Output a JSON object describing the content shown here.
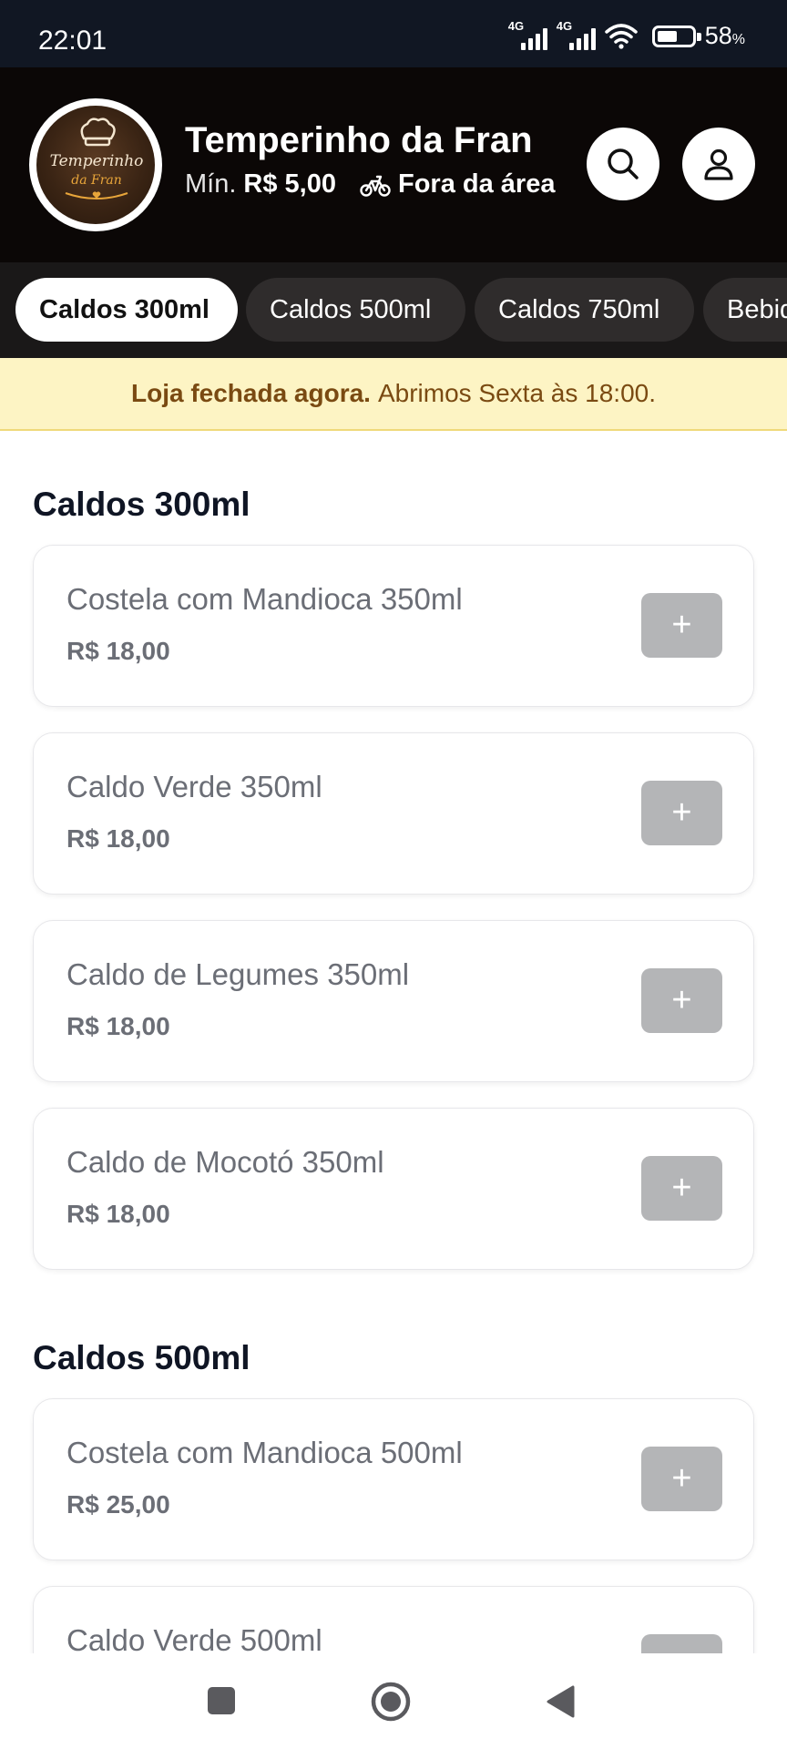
{
  "status_bar": {
    "time": "22:01",
    "network_1": "4G",
    "network_2": "4G",
    "battery_percent": "58",
    "battery_unit": "%",
    "battery_level": 0.58
  },
  "store": {
    "name": "Temperinho da Fran",
    "logo_text_1": "Temperinho",
    "logo_text_2": "da Fran",
    "min_label": "Mín.",
    "min_value": "R$ 5,00",
    "delivery_status": "Fora da área"
  },
  "tabs": [
    {
      "label": "Caldos 300ml",
      "active": true
    },
    {
      "label": "Caldos 500ml",
      "active": false
    },
    {
      "label": "Caldos 750ml",
      "active": false
    },
    {
      "label": "Bebidas",
      "active": false
    }
  ],
  "banner": {
    "strong": "Loja fechada agora.",
    "text": "Abrimos Sexta às 18:00."
  },
  "sections": [
    {
      "title": "Caldos 300ml",
      "products": [
        {
          "name": "Costela com Mandioca 350ml",
          "price": "R$ 18,00"
        },
        {
          "name": "Caldo Verde 350ml",
          "price": "R$ 18,00"
        },
        {
          "name": "Caldo de Legumes 350ml",
          "price": "R$ 18,00"
        },
        {
          "name": "Caldo de Mocotó 350ml",
          "price": "R$ 18,00"
        }
      ]
    },
    {
      "title": "Caldos 500ml",
      "products": [
        {
          "name": "Costela com Mandioca 500ml",
          "price": "R$ 25,00"
        },
        {
          "name": "Caldo Verde 500ml",
          "price": ""
        }
      ]
    }
  ],
  "add_symbol": "+",
  "colors": {
    "header_bg": "#0b0706",
    "tabs_bg": "#1a1818",
    "banner_bg": "#fdf4c4",
    "banner_text": "#7a4a12",
    "disabled_button": "#b4b5b7"
  },
  "icons": {
    "search": "search-icon",
    "user": "user-icon",
    "bike": "bike-icon",
    "nav_recents": "square-icon",
    "nav_home": "circle-icon",
    "nav_back": "triangle-back-icon"
  }
}
